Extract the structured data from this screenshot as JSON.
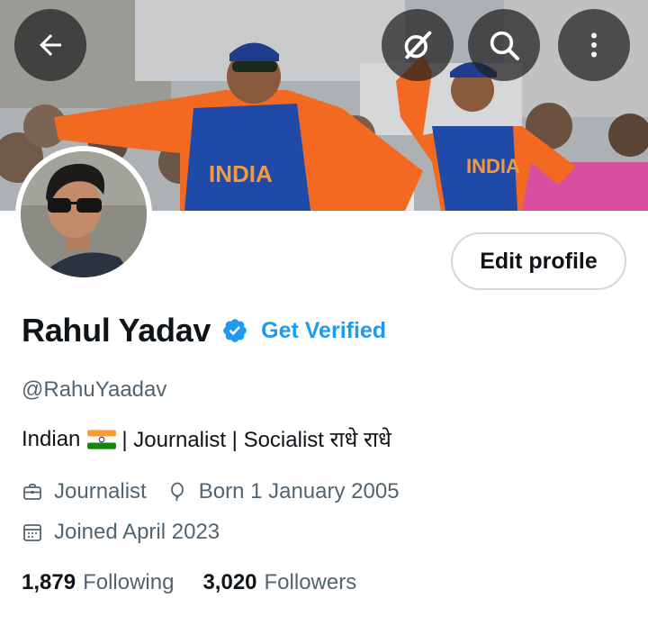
{
  "profile": {
    "name": "Rahul Yadav",
    "get_verified": "Get Verified",
    "handle": "@RahuYaadav",
    "bio_before_flag": "Indian",
    "bio_after_flag": "| Journalist | Socialist राधे राधे",
    "profession": "Journalist",
    "birth": "Born 1 January 2005",
    "joined": "Joined April 2023",
    "following_count": "1,879",
    "following_label": "Following",
    "followers_count": "3,020",
    "followers_label": "Followers"
  },
  "header": {
    "edit_profile_label": "Edit profile",
    "jersey_text": "INDIA"
  },
  "icons": {
    "back": "arrow-left-icon",
    "grok": "grok-icon",
    "search": "search-icon",
    "more": "more-vertical-icon",
    "verified": "verified-badge-icon",
    "profession": "briefcase-icon",
    "birth": "balloon-icon",
    "joined": "calendar-icon"
  },
  "colors": {
    "accent": "#1d9bf0",
    "text": "#0f1419",
    "muted": "#536471",
    "border": "#cfd9de"
  }
}
